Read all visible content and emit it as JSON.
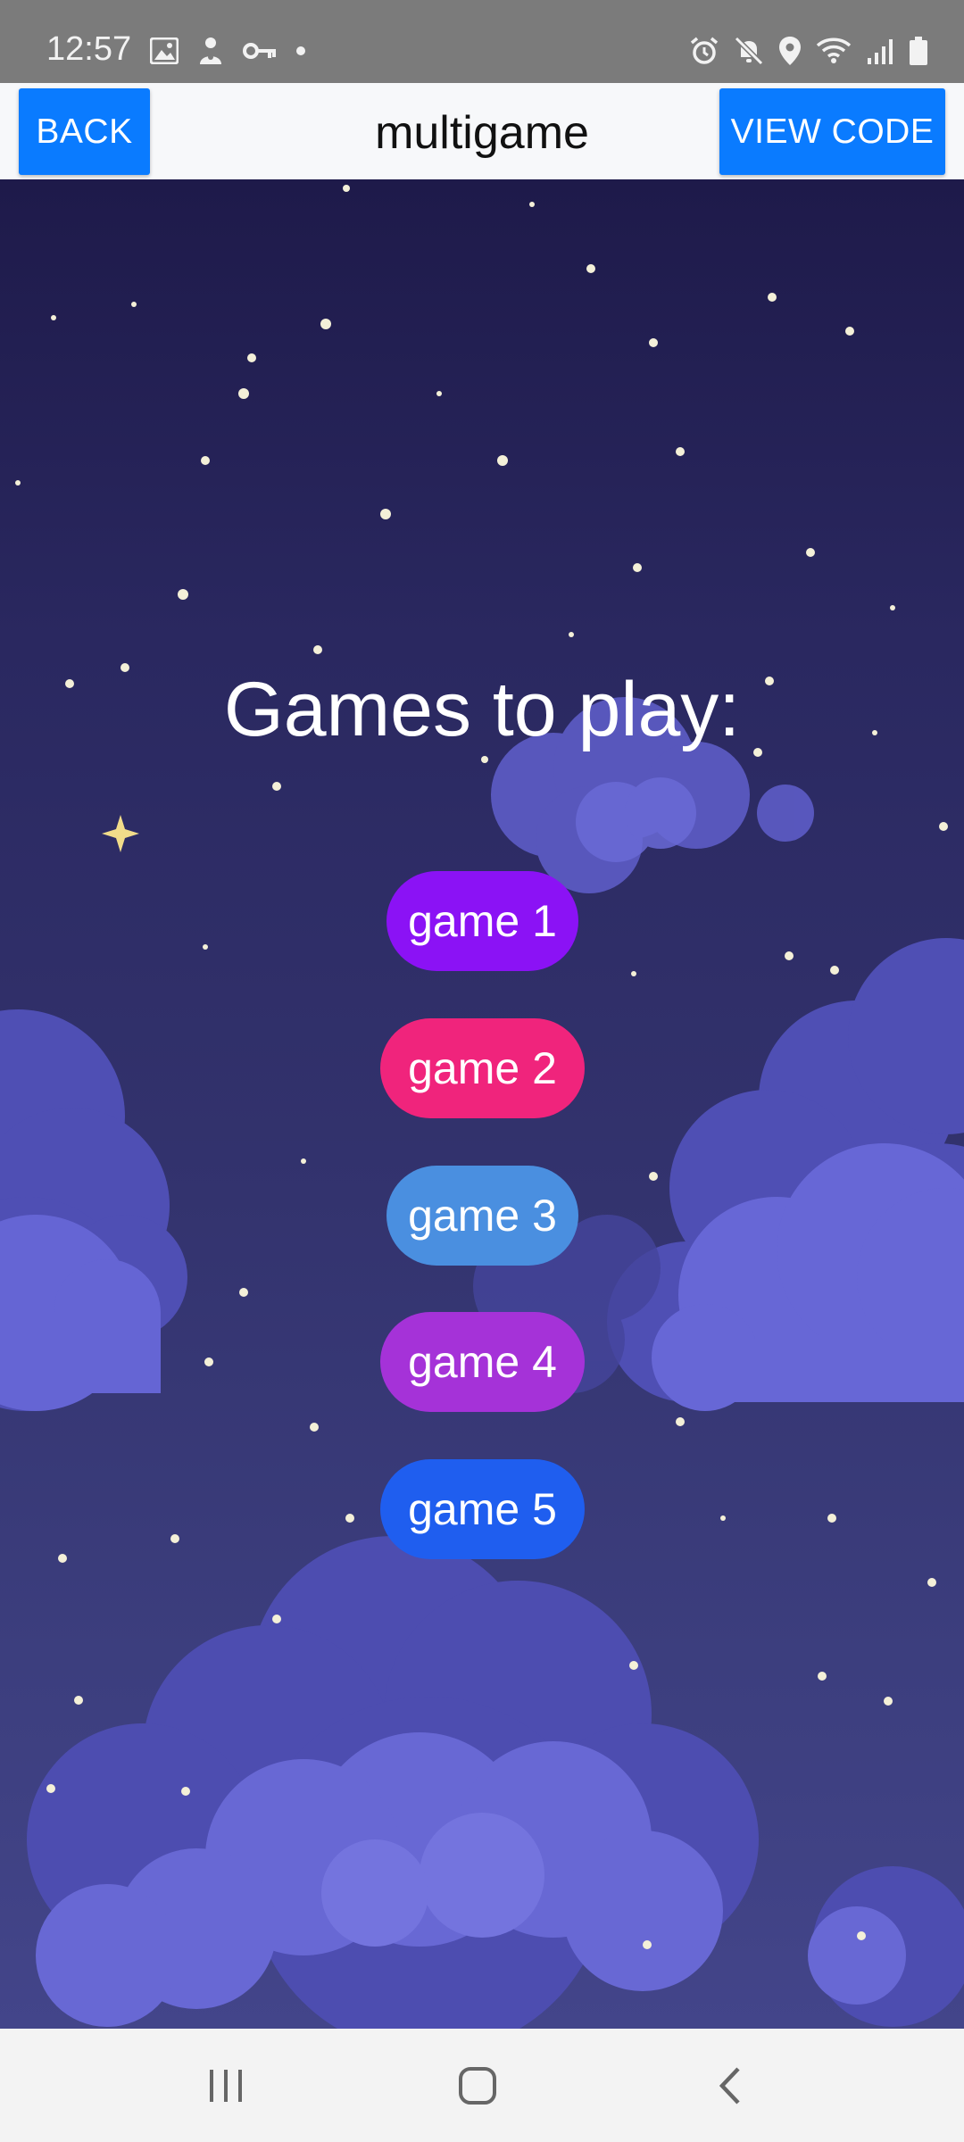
{
  "status_bar": {
    "time": "12:57",
    "left_icons": [
      "image-icon",
      "notification-person-icon",
      "key-icon",
      "dot-icon"
    ],
    "right_icons": [
      "alarm-icon",
      "mute-icon",
      "location-icon",
      "wifi-icon",
      "signal-icon",
      "battery-icon"
    ]
  },
  "header": {
    "back_label": "BACK",
    "title": "multigame",
    "view_code_label": "VIEW CODE"
  },
  "main": {
    "heading": "Games to play:",
    "games": [
      {
        "label": "game 1",
        "color": "#8b12f5"
      },
      {
        "label": "game 2",
        "color": "#f0247c"
      },
      {
        "label": "game 3",
        "color": "#4a8fe0"
      },
      {
        "label": "game 4",
        "color": "#a532d8"
      },
      {
        "label": "game 5",
        "color": "#1f5eef"
      }
    ]
  },
  "nav_bar": {
    "items": [
      "recent-apps-icon",
      "home-icon",
      "back-icon"
    ]
  },
  "colors": {
    "primary_button": "#0a7bff",
    "sky_top": "#1e1a4a",
    "sky_bottom": "#43458a",
    "cloud": "#6a6ad6"
  }
}
